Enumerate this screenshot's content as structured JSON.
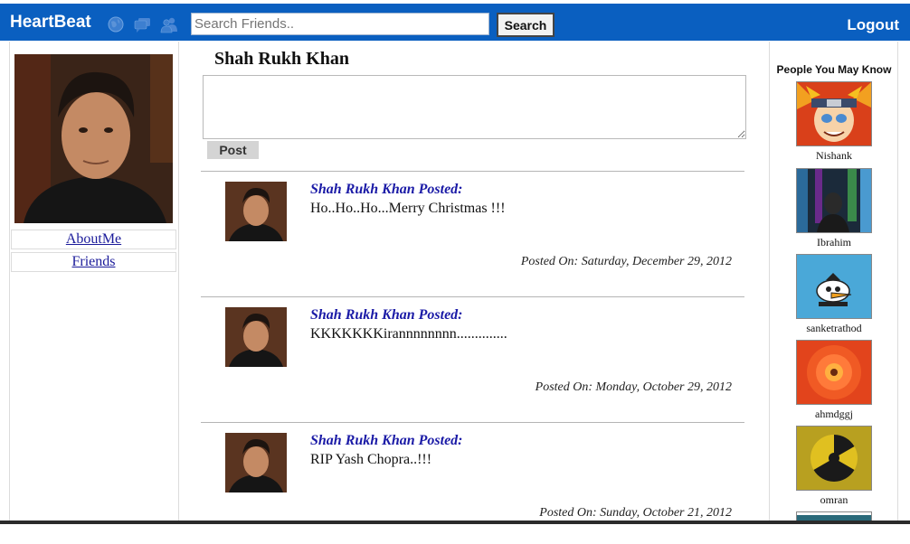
{
  "topbar": {
    "brand": "HeartBeat",
    "icons": [
      "globe-icon",
      "messages-icon",
      "friends-icon"
    ],
    "search_placeholder": "Search Friends..",
    "search_button": "Search",
    "logout": "Logout",
    "bar_color": "#0a5fc0"
  },
  "left": {
    "links": [
      "AboutMe",
      "Friends"
    ]
  },
  "main": {
    "profile_name": "Shah Rukh Khan",
    "post_button": "Post",
    "posts": [
      {
        "author": "Shah Rukh Khan Posted:",
        "text": "Ho..Ho..Ho...Merry Christmas !!!",
        "date": "Posted On: Saturday, December 29, 2012"
      },
      {
        "author": "Shah Rukh Khan Posted:",
        "text": "KKKKKKKirannnnnnnn..............",
        "date": "Posted On: Monday, October 29, 2012"
      },
      {
        "author": "Shah Rukh Khan Posted:",
        "text": "RIP Yash Chopra..!!!",
        "date": "Posted On: Sunday, October 21, 2012"
      }
    ]
  },
  "sidebar": {
    "title": "People You May Know",
    "people": [
      {
        "name": "Nishank"
      },
      {
        "name": "Ibrahim"
      },
      {
        "name": "sanketrathod"
      },
      {
        "name": "ahmdggj"
      },
      {
        "name": "omran"
      }
    ]
  }
}
